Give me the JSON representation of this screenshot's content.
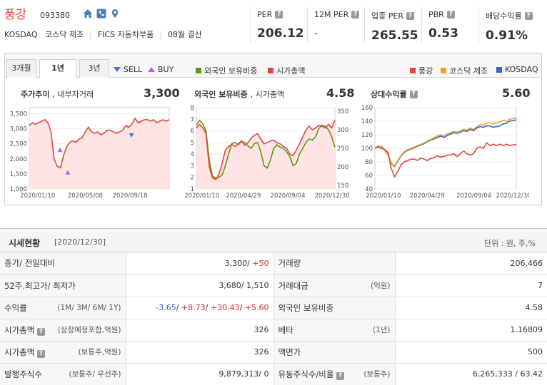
{
  "company": {
    "name": "풍강",
    "code": "093380",
    "market": "KOSDAQ",
    "industry": "코스닥 제조",
    "fics": "FICS 자동차부품",
    "settle": "08월 결산"
  },
  "metrics": [
    {
      "label": "PER",
      "value": "206.12",
      "help": true
    },
    {
      "label": "12M PER",
      "value": "-",
      "help": true
    },
    {
      "label": "업종 PER",
      "value": "265.55",
      "help": true
    },
    {
      "label": "PBR",
      "value": "0.53",
      "help": true
    },
    {
      "label": "배당수익률",
      "value": "0.91%",
      "help": true
    }
  ],
  "controls": {
    "tabs": [
      "3개월",
      "1년",
      "3년"
    ],
    "active_tab": "1년",
    "sell_label": "SELL",
    "buy_label": "BUY",
    "legend_mid": [
      {
        "label": "외국인 보유비중",
        "color": "#5a9a12"
      },
      {
        "label": "시가총액",
        "color": "#e0473d"
      }
    ],
    "legend_right": [
      {
        "label": "풍강",
        "color": "#e0473d"
      },
      {
        "label": "코스닥 제조",
        "color": "#f4a21a"
      },
      {
        "label": "KOSDAQ",
        "color": "#3566c8"
      }
    ]
  },
  "panels": {
    "price": {
      "title_bold": "주가추이",
      "title_rest": ", 내부자거래",
      "value": "3,300"
    },
    "foreign": {
      "title_bold": "외국인 보유비중",
      "title_rest": ", 시가총액",
      "value": "4.58"
    },
    "relative": {
      "title_bold": "상대수익률",
      "value": "5.60"
    }
  },
  "chart_data": [
    {
      "type": "line",
      "name": "주가추이",
      "ylim": [
        1000,
        3700
      ],
      "y_ticks": [
        "3,500",
        "3,000",
        "2,500",
        "2,000",
        "1,500",
        "1,000"
      ],
      "y_tick_values": [
        3500,
        3000,
        2500,
        2000,
        1500,
        1000
      ],
      "x_ticks": [
        "2020/01/10",
        "2020/05/08",
        "2020/09/18"
      ],
      "x_tick_pos": [
        0.06,
        0.4,
        0.72
      ],
      "series": [
        {
          "color": "#e0473d",
          "fill": "#fde3e3",
          "values": [
            3100,
            3200,
            3150,
            3200,
            3250,
            3300,
            3200,
            2900,
            2000,
            1750,
            1700,
            2100,
            2400,
            2550,
            2600,
            2550,
            2650,
            2700,
            2900,
            3050,
            2900,
            2850,
            2900,
            2800,
            2850,
            2950,
            2950,
            2900,
            2850,
            2900,
            2950,
            3100,
            3050,
            3150,
            3350,
            3200,
            3250,
            3300,
            3300,
            3250,
            3300,
            3200,
            3250,
            3300,
            3250,
            3300
          ]
        }
      ],
      "markers": [
        {
          "kind": "buy",
          "x": 0.22,
          "y": 2300
        },
        {
          "kind": "buy",
          "x": 0.275,
          "y": 1550
        },
        {
          "kind": "sell",
          "x": 0.73,
          "y": 2780
        }
      ]
    },
    {
      "type": "line",
      "name": "외국인 보유비중 / 시가총액",
      "ylim_left": [
        1,
        8
      ],
      "y_ticks_left": [
        "8",
        "7",
        "6",
        "5",
        "4",
        "3",
        "2",
        "1"
      ],
      "y_tick_values_left": [
        8,
        7,
        6,
        5,
        4,
        3,
        2,
        1
      ],
      "ylim_right": [
        140,
        360
      ],
      "y_ticks_right": [
        "350",
        "300",
        "250",
        "200",
        "150"
      ],
      "y_tick_values_right": [
        350,
        300,
        250,
        200,
        150
      ],
      "x_ticks": [
        "2020/01/10",
        "2020/04/29",
        "2020/09/04",
        "2020/12/30"
      ],
      "x_tick_pos": [
        0.04,
        0.34,
        0.66,
        0.98
      ],
      "series": [
        {
          "name": "외국인 보유비중",
          "axis": "left",
          "color": "#5a9a12",
          "values": [
            6.5,
            6.9,
            6.6,
            6.0,
            3.5,
            2.1,
            1.9,
            2.0,
            2.2,
            3.0,
            4.0,
            4.9,
            5.0,
            4.8,
            5.1,
            5.0,
            4.7,
            4.5,
            4.9,
            5.0,
            4.2,
            3.0,
            2.8,
            3.5,
            4.5,
            4.8,
            4.6,
            4.5,
            4.2,
            3.8,
            3.0,
            3.2,
            4.0,
            4.5,
            5.0,
            5.3,
            5.2,
            5.5,
            6.2,
            6.5,
            6.4,
            6.1,
            5.5,
            4.58
          ]
        },
        {
          "name": "시가총액",
          "axis": "right",
          "color": "#e0473d",
          "fill": "#fde3e3",
          "values": [
            305,
            315,
            305,
            290,
            200,
            170,
            165,
            180,
            210,
            245,
            255,
            260,
            255,
            262,
            270,
            258,
            265,
            278,
            285,
            290,
            275,
            262,
            265,
            270,
            272,
            265,
            262,
            255,
            250,
            235,
            230,
            245,
            262,
            280,
            300,
            310,
            300,
            305,
            312,
            310,
            305,
            315,
            305,
            326
          ]
        }
      ]
    },
    {
      "type": "line",
      "name": "상대수익률",
      "ylim": [
        40,
        160
      ],
      "y_ticks": [
        "160",
        "140",
        "120",
        "100",
        "80",
        "60",
        "40"
      ],
      "y_tick_values": [
        160,
        140,
        120,
        100,
        80,
        60,
        40
      ],
      "x_ticks": [
        "2020/01/10",
        "2020/04/29",
        "2020/09/04",
        "2020/12/30"
      ],
      "x_tick_pos": [
        0.06,
        0.37,
        0.7,
        0.98
      ],
      "series": [
        {
          "name": "풍강",
          "color": "#e0473d",
          "values": [
            100,
            102,
            100,
            98,
            94,
            70,
            58,
            66,
            76,
            80,
            82,
            84,
            84,
            82,
            86,
            84,
            82,
            85,
            86,
            89,
            87,
            88,
            90,
            90,
            92,
            88,
            92,
            96,
            92,
            90,
            92,
            100,
            102,
            100,
            108,
            104,
            106,
            104,
            106,
            104,
            106,
            104,
            105,
            105.6
          ]
        },
        {
          "name": "코스닥 제조",
          "color": "#f4a21a",
          "values": [
            100,
            102,
            103,
            98,
            90,
            78,
            74,
            82,
            90,
            95,
            98,
            100,
            102,
            104,
            106,
            108,
            111,
            113,
            116,
            118,
            120,
            118,
            121,
            123,
            125,
            124,
            126,
            128,
            127,
            130,
            128,
            132,
            135,
            134,
            137,
            138,
            136,
            138,
            139,
            141,
            140,
            143,
            144,
            145
          ]
        },
        {
          "name": "KOSDAQ",
          "color": "#3566c8",
          "values": [
            100,
            103,
            102,
            97,
            90,
            77,
            73,
            81,
            89,
            94,
            97,
            99,
            101,
            103,
            105,
            107,
            110,
            112,
            114,
            116,
            118,
            116,
            119,
            121,
            123,
            122,
            124,
            126,
            125,
            128,
            126,
            130,
            132,
            131,
            133,
            133,
            131,
            132,
            133,
            136,
            137,
            140,
            141,
            142
          ]
        }
      ]
    }
  ],
  "market": {
    "title": "시세현황",
    "date": "[2020/12/30]",
    "unit": "단위 : 원, 주,%",
    "rows": [
      {
        "k1": "종가/ 전일대비",
        "k1_sub": "",
        "k1_help": false,
        "v1": [
          {
            "t": "3,300/ ",
            "c": ""
          },
          {
            "t": "+50",
            "c": "up"
          }
        ],
        "k2": "거래량",
        "k2_sub": "",
        "k2_help": false,
        "v2": "206,466"
      },
      {
        "k1": "52주.최고가/ 최저가",
        "k1_sub": "",
        "k1_help": false,
        "v1": [
          {
            "t": "3,680/ 1,510",
            "c": ""
          }
        ],
        "k2": "거래대금",
        "k2_sub": "(억원)",
        "k2_help": false,
        "v2": "7"
      },
      {
        "k1": "수익률",
        "k1_sub": "(1M/ 3M/ 6M/ 1Y)",
        "k1_help": false,
        "v1": [
          {
            "t": "-3.65",
            "c": "dn"
          },
          {
            "t": "/ ",
            "c": ""
          },
          {
            "t": "+8.73",
            "c": "up"
          },
          {
            "t": "/ ",
            "c": ""
          },
          {
            "t": "+30.43",
            "c": "up"
          },
          {
            "t": "/ ",
            "c": ""
          },
          {
            "t": "+5.60",
            "c": "up"
          }
        ],
        "k2": "외국인 보유비중",
        "k2_sub": "",
        "k2_help": false,
        "v2": "4.58"
      },
      {
        "k1": "시가총액",
        "k1_sub": "(상장예정포함,억원)",
        "k1_help": true,
        "v1": [
          {
            "t": "326",
            "c": ""
          }
        ],
        "k2": "베타",
        "k2_sub": "(1년)",
        "k2_help": false,
        "v2": "1.16809"
      },
      {
        "k1": "시가총액",
        "k1_sub": "(보통주,억원)",
        "k1_help": true,
        "v1": [
          {
            "t": "326",
            "c": ""
          }
        ],
        "k2": "액면가",
        "k2_sub": "",
        "k2_help": false,
        "v2": "500"
      },
      {
        "k1": "발행주식수",
        "k1_sub": "(보통주/ 우선주)",
        "k1_help": false,
        "v1": [
          {
            "t": "9,879,313/ 0",
            "c": ""
          }
        ],
        "k2": "유동주식수/비율",
        "k2_sub": "(보통주)",
        "k2_help": true,
        "v2": "6,265,333 / 63.42"
      }
    ]
  }
}
